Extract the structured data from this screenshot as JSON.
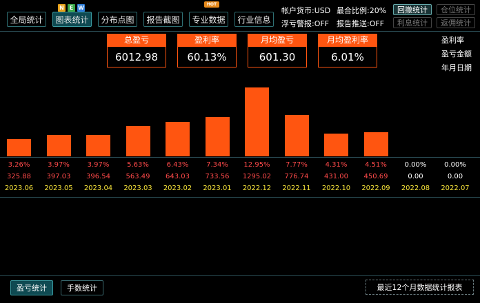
{
  "tabs": [
    {
      "label": "全局统计"
    },
    {
      "label": "图表统计",
      "active": true
    },
    {
      "label": "分布点图"
    },
    {
      "label": "报告截图"
    },
    {
      "label": "专业数据"
    },
    {
      "label": "行业信息"
    }
  ],
  "badges": {
    "new": [
      "N",
      "E",
      "W"
    ],
    "new_colors": [
      "#e8a21a",
      "#3aa84a",
      "#2b7bd6"
    ],
    "hot": "HOT"
  },
  "account": {
    "currency_label": "帐户货币:USD",
    "float_alert_label": "浮亏警报:OFF",
    "margin_ratio_label": "最合比例:20%",
    "report_push_label": "报告推送:OFF"
  },
  "right_buttons": {
    "withdraw_stats": "回撤统计",
    "position_stats": "仓位统计",
    "interest_stats": "利息统计",
    "rebate_stats": "返佣统计"
  },
  "summary_cards": [
    {
      "title": "总盈亏",
      "value": "6012.98"
    },
    {
      "title": "盈利率",
      "value": "60.13%"
    },
    {
      "title": "月均盈亏",
      "value": "601.30"
    },
    {
      "title": "月均盈利率",
      "value": "6.01%"
    }
  ],
  "legend": [
    "盈利率",
    "盈亏金额",
    "年月日期"
  ],
  "colors": {
    "accent": "#ff5510",
    "date": "#f5e23a",
    "rate": "#ff4a4a"
  },
  "chart_data": {
    "type": "bar",
    "categories": [
      "2023.06",
      "2023.05",
      "2023.04",
      "2023.03",
      "2023.02",
      "2023.01",
      "2022.12",
      "2022.11",
      "2022.10",
      "2022.09",
      "2022.08",
      "2022.07"
    ],
    "values": [
      325.88,
      397.03,
      396.54,
      563.49,
      643.03,
      733.56,
      1295.02,
      776.74,
      431.0,
      450.69,
      0.0,
      0.0
    ],
    "value_labels": [
      "325.88",
      "397.03",
      "396.54",
      "563.49",
      "643.03",
      "733.56",
      "1295.02",
      "776.74",
      "431.00",
      "450.69",
      "0.00",
      "0.00"
    ],
    "rates": [
      "3.26%",
      "3.97%",
      "3.97%",
      "5.63%",
      "6.43%",
      "7.34%",
      "12.95%",
      "7.77%",
      "4.31%",
      "4.51%",
      "0.00%",
      "0.00%"
    ],
    "ylim": [
      0,
      1295.02
    ]
  },
  "bottom": {
    "profit_stats": "盈亏统计",
    "lot_stats": "手数统计",
    "report_label": "最近12个月数据统计报表"
  }
}
